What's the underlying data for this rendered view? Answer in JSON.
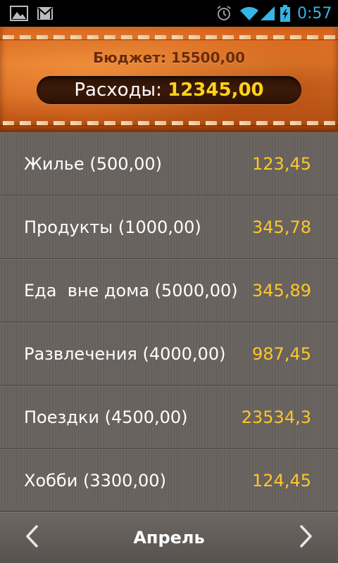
{
  "status_bar": {
    "time": "0:57",
    "icons": [
      "gallery-icon",
      "gmail-icon",
      "alarm-icon",
      "wifi-icon",
      "signal-icon",
      "battery-charging-icon"
    ],
    "accent_color": "#33b5e5"
  },
  "header": {
    "budget_label": "Бюджет: ",
    "budget_value": "15500,00",
    "expenses_label": "Расходы: ",
    "expenses_value": "12345,00",
    "background_color": "#d96a22",
    "expenses_value_color": "#ffd21a"
  },
  "categories": [
    {
      "name": "Жилье (500,00)",
      "amount": "123,45"
    },
    {
      "name": "Продукты (1000,00)",
      "amount": "345,78"
    },
    {
      "name": "Еда  вне дома (5000,00)",
      "amount": "345,89"
    },
    {
      "name": "Развлечения (4000,00)",
      "amount": "987,45"
    },
    {
      "name": "Поездки (4500,00)",
      "amount": "23534,3"
    },
    {
      "name": "Хобби (3300,00)",
      "amount": "124,45"
    }
  ],
  "month_nav": {
    "month": "Апрель",
    "prev_icon": "chevron-left-icon",
    "next_icon": "chevron-right-icon"
  },
  "colors": {
    "list_background": "#6a6460",
    "amount_text": "#ffc62a"
  }
}
